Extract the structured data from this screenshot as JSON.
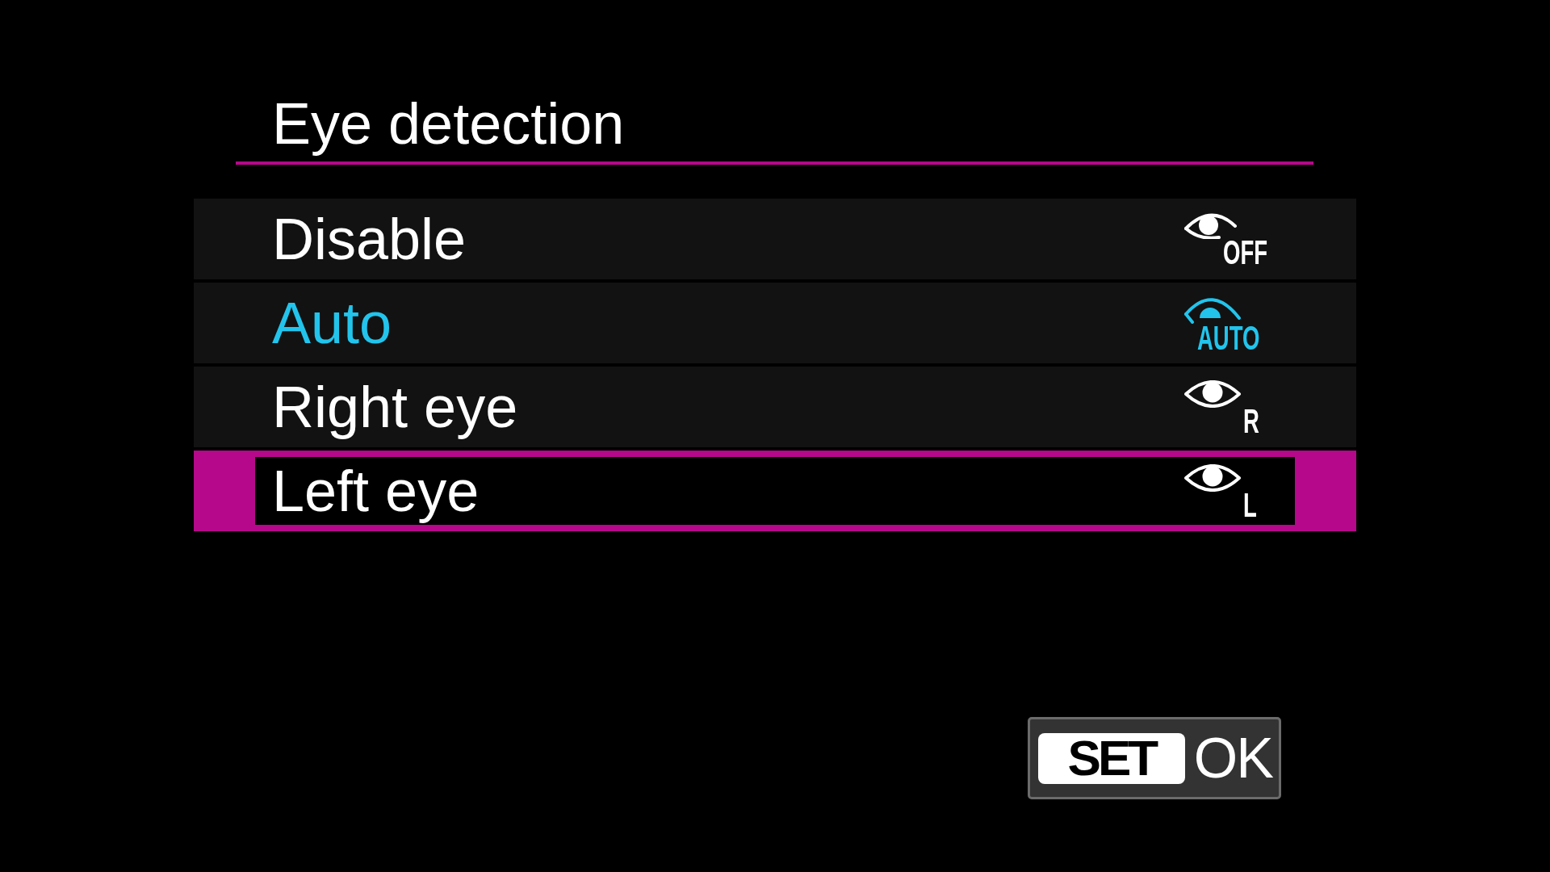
{
  "screen": {
    "title": "Eye detection"
  },
  "options": [
    {
      "label": "Disable",
      "kind": "off",
      "icon_text": "OFF",
      "current": false,
      "selected": false
    },
    {
      "label": "Auto",
      "kind": "auto",
      "icon_text": "AUTO",
      "current": true,
      "selected": false
    },
    {
      "label": "Right eye",
      "kind": "eye",
      "icon_text": "R",
      "current": false,
      "selected": false
    },
    {
      "label": "Left eye",
      "kind": "eye",
      "icon_text": "L",
      "current": false,
      "selected": true
    }
  ],
  "confirm_button": {
    "key": "SET",
    "label": "OK"
  }
}
